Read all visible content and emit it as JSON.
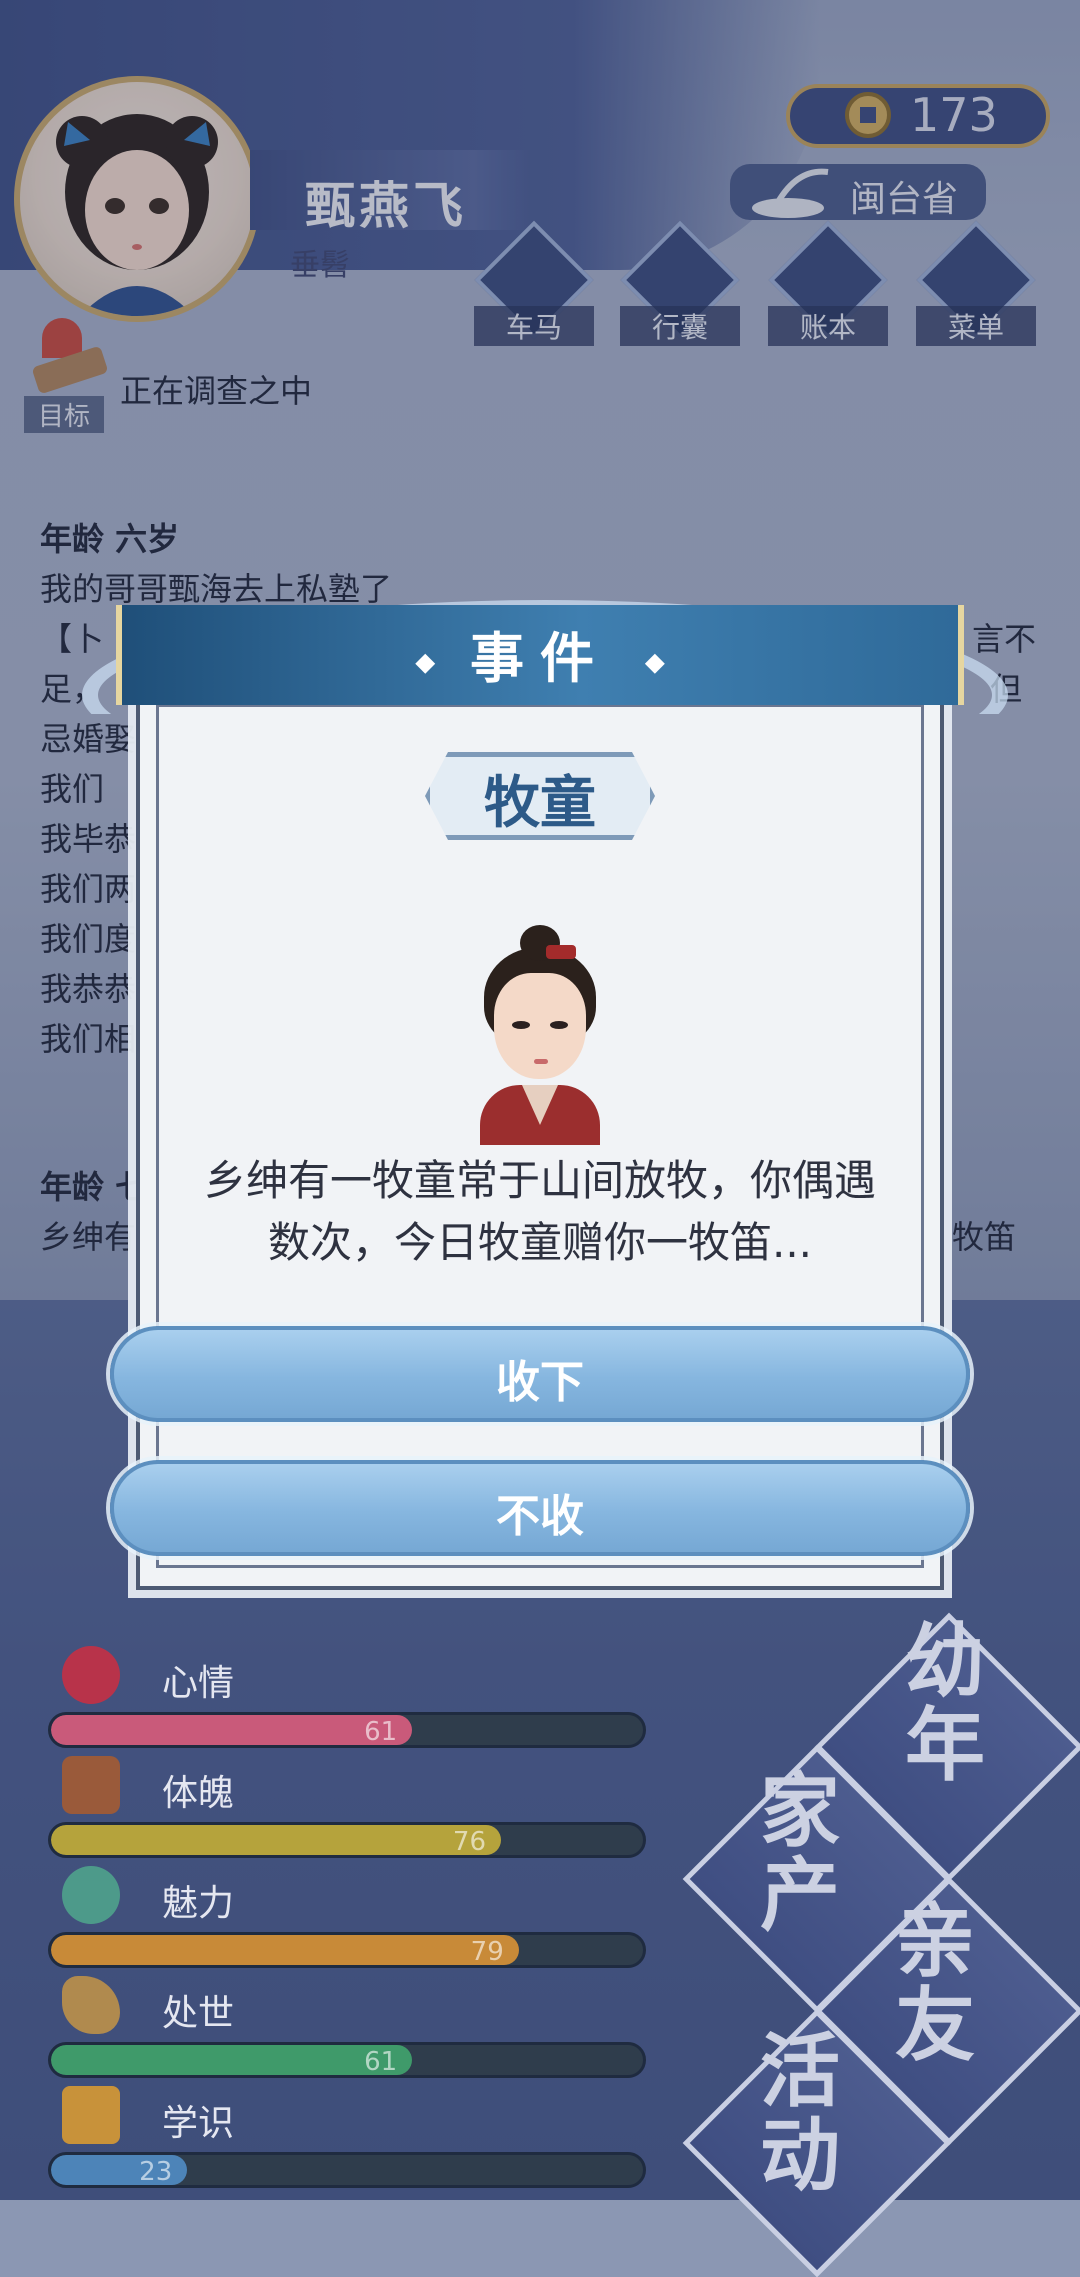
{
  "header": {
    "player_name": "甄燕飞",
    "player_title": "垂髫",
    "coins": "173",
    "province": "闽台省",
    "nav_buttons": [
      {
        "label": "车马",
        "icon": "carriage-icon"
      },
      {
        "label": "行囊",
        "icon": "bag-icon"
      },
      {
        "label": "账本",
        "icon": "ledger-icon"
      },
      {
        "label": "菜单",
        "icon": "menu-icon"
      }
    ],
    "target_label": "目标"
  },
  "log": {
    "line_top": "正在调查之中",
    "age6_heading": "年龄 六岁",
    "age6_lines": [
      "我的哥哥甄海去上私塾了",
      "【卜",
      "足，",
      "忌婚娶",
      "我们",
      "我毕恭",
      "我们两",
      "我们度",
      "我恭恭",
      "我们相"
    ],
    "right_fragments": [
      "言不",
      "但"
    ],
    "age7_heading": "年龄 七",
    "age7_line": "乡绅有",
    "age7_tail": "牧笛"
  },
  "event": {
    "title": "事件",
    "npc_name": "牧童",
    "npc_icon": "shepherd-boy-portrait",
    "description": "乡绅有一牧童常于山间放牧，你偶遇数次，今日牧童赠你一牧笛...",
    "choices": [
      "收下",
      "不收"
    ]
  },
  "stats": [
    {
      "label": "心情",
      "value": "61",
      "fraction": 0.61,
      "color": "#c95a7a",
      "icon": "flower-icon"
    },
    {
      "label": "体魄",
      "value": "76",
      "fraction": 0.76,
      "color": "#b5a33c",
      "icon": "hydrant-icon"
    },
    {
      "label": "魅力",
      "value": "79",
      "fraction": 0.79,
      "color": "#c88a38",
      "icon": "jade-icon"
    },
    {
      "label": "处世",
      "value": "61",
      "fraction": 0.61,
      "color": "#3f9a6a",
      "icon": "sleeve-icon"
    },
    {
      "label": "学识",
      "value": "23",
      "fraction": 0.23,
      "color": "#4d84b8",
      "icon": "brush-pot-icon"
    }
  ],
  "phases": [
    {
      "label": "幼年"
    },
    {
      "label": "家产"
    },
    {
      "label": "亲友"
    },
    {
      "label": "活动"
    }
  ]
}
